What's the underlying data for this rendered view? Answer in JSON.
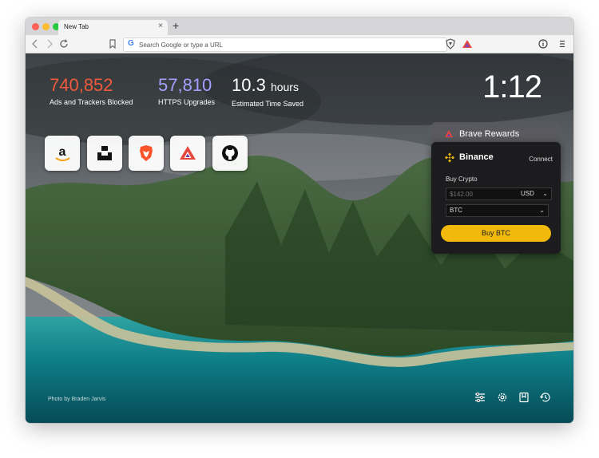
{
  "browser": {
    "tab_title": "New Tab",
    "tab_close": "×",
    "new_tab": "+",
    "url_placeholder": "Search Google or type a URL"
  },
  "stats": {
    "ads_blocked": {
      "value": "740,852",
      "label": "Ads and Trackers Blocked",
      "color": "#ef5a3c"
    },
    "https_upgrades": {
      "value": "57,810",
      "label": "HTTPS Upgrades",
      "color": "#a3a0ff"
    },
    "time_saved": {
      "value": "10.3",
      "unit": "hours",
      "label": "Estimated Time Saved",
      "color": "#ffffff"
    }
  },
  "clock": "1:12",
  "top_sites": [
    {
      "name": "amazon-icon"
    },
    {
      "name": "unsplash-icon"
    },
    {
      "name": "brave-icon"
    },
    {
      "name": "bat-icon"
    },
    {
      "name": "github-icon"
    }
  ],
  "rewards": {
    "title": "Brave Rewards"
  },
  "binance": {
    "title": "Binance",
    "connect": "Connect",
    "buy_label": "Buy Crypto",
    "amount_placeholder": "$142.00",
    "currency": "USD",
    "coin": "BTC",
    "buy_button": "Buy BTC",
    "accent": "#f0b90b"
  },
  "credit": "Photo by Braden Jarvis"
}
